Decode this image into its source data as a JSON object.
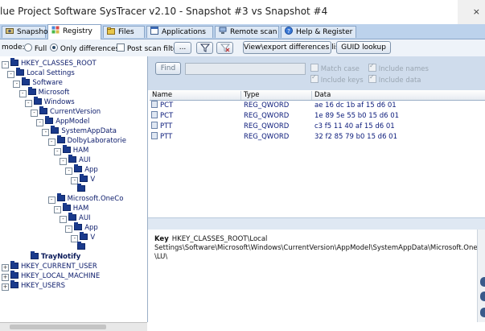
{
  "window": {
    "title": "lue Project Software SysTracer v2.10 - Snapshot #3 vs Snapshot #4",
    "corner_glyph": "×"
  },
  "tabs": [
    {
      "label": "Snapshots",
      "icon": "camera-icon",
      "active": false
    },
    {
      "label": "Registry",
      "icon": "registry-icon",
      "active": true
    },
    {
      "label": "Files",
      "icon": "folder-icon",
      "active": false
    },
    {
      "label": "Applications",
      "icon": "window-icon",
      "active": false
    },
    {
      "label": "Remote scan",
      "icon": "network-icon",
      "active": false
    },
    {
      "label": "Help & Register",
      "icon": "help-icon",
      "active": false
    }
  ],
  "toolbar": {
    "mode_label": "mode:",
    "mode_full": "Full",
    "mode_only_diff": "Only differences",
    "post_scan_filter": "Post scan filter",
    "ellipsis": "...",
    "filter_icon": "filter-icon",
    "clear_filter_icon": "clear-filter-icon",
    "view_export": "View\\export differences list",
    "guid_lookup": "GUID lookup"
  },
  "tree": [
    {
      "label": "HKEY_CLASSES_ROOT",
      "depth": 0,
      "box": "-",
      "bold": false
    },
    {
      "label": "Local Settings",
      "depth": 1,
      "box": "-",
      "bold": false
    },
    {
      "label": "Software",
      "depth": 2,
      "box": "-",
      "bold": false
    },
    {
      "label": "Microsoft",
      "depth": 3,
      "box": "-",
      "bold": false
    },
    {
      "label": "Windows",
      "depth": 4,
      "box": "-",
      "bold": false
    },
    {
      "label": "CurrentVersion",
      "depth": 5,
      "box": "-",
      "bold": false
    },
    {
      "label": "AppModel",
      "depth": 6,
      "box": "-",
      "bold": false
    },
    {
      "label": "SystemAppData",
      "depth": 7,
      "box": "-",
      "bold": false
    },
    {
      "label": "DolbyLaboratorie",
      "depth": 8,
      "box": "-",
      "bold": false
    },
    {
      "label": "HAM",
      "depth": 9,
      "box": "-",
      "bold": false
    },
    {
      "label": "AUI",
      "depth": 10,
      "box": "-",
      "bold": false
    },
    {
      "label": "App",
      "depth": 11,
      "box": "-",
      "bold": false
    },
    {
      "label": "V",
      "depth": 12,
      "box": "-",
      "bold": false
    },
    {
      "label": "",
      "depth": 13,
      "box": "",
      "bold": false
    },
    {
      "label": "Microsoft.OneCo",
      "depth": 8,
      "box": "-",
      "bold": false
    },
    {
      "label": "HAM",
      "depth": 9,
      "box": "-",
      "bold": false
    },
    {
      "label": "AUI",
      "depth": 10,
      "box": "-",
      "bold": false
    },
    {
      "label": "App",
      "depth": 11,
      "box": "-",
      "bold": false
    },
    {
      "label": "V",
      "depth": 12,
      "box": "-",
      "bold": false
    },
    {
      "label": "",
      "depth": 13,
      "box": "",
      "bold": false
    },
    {
      "label": "TrayNotify",
      "depth": 5,
      "box": "",
      "bold": true
    },
    {
      "label": "HKEY_CURRENT_USER",
      "depth": 0,
      "box": "+",
      "bold": false
    },
    {
      "label": "HKEY_LOCAL_MACHINE",
      "depth": 0,
      "box": "+",
      "bold": false
    },
    {
      "label": "HKEY_USERS",
      "depth": 0,
      "box": "+",
      "bold": false
    }
  ],
  "search": {
    "find_button": "Find",
    "find_value": "",
    "match_case": "Match case",
    "include_keys": "Include keys",
    "include_names": "Include names",
    "include_data": "Include data"
  },
  "grid": {
    "columns": [
      "Name",
      "Type",
      "Data"
    ],
    "rows": [
      {
        "name": "PCT",
        "type": "REG_QWORD",
        "data": "ae 16 dc 1b af 15 d6 01"
      },
      {
        "name": "PCT",
        "type": "REG_QWORD",
        "data": "1e 89 5e 55 b0 15 d6 01"
      },
      {
        "name": "PTT",
        "type": "REG_QWORD",
        "data": "c3 f5 11 40 af 15 d6 01"
      },
      {
        "name": "PTT",
        "type": "REG_QWORD",
        "data": "32 f2 85 79 b0 15 d6 01"
      }
    ]
  },
  "detail": {
    "label": "Key",
    "line1": "HKEY_CLASSES_ROOT\\Local",
    "line2": "Settings\\Software\\Microsoft\\Windows\\CurrentVersion\\AppModel\\SystemAppData\\Microsoft.OneConnect_",
    "line3": "\\LU\\"
  },
  "colors": {
    "tab_strip": "#bcd2ec",
    "folder": "#1a3a8c",
    "tree_text": "#0a1a6a",
    "search_pane": "#cfdcec"
  }
}
